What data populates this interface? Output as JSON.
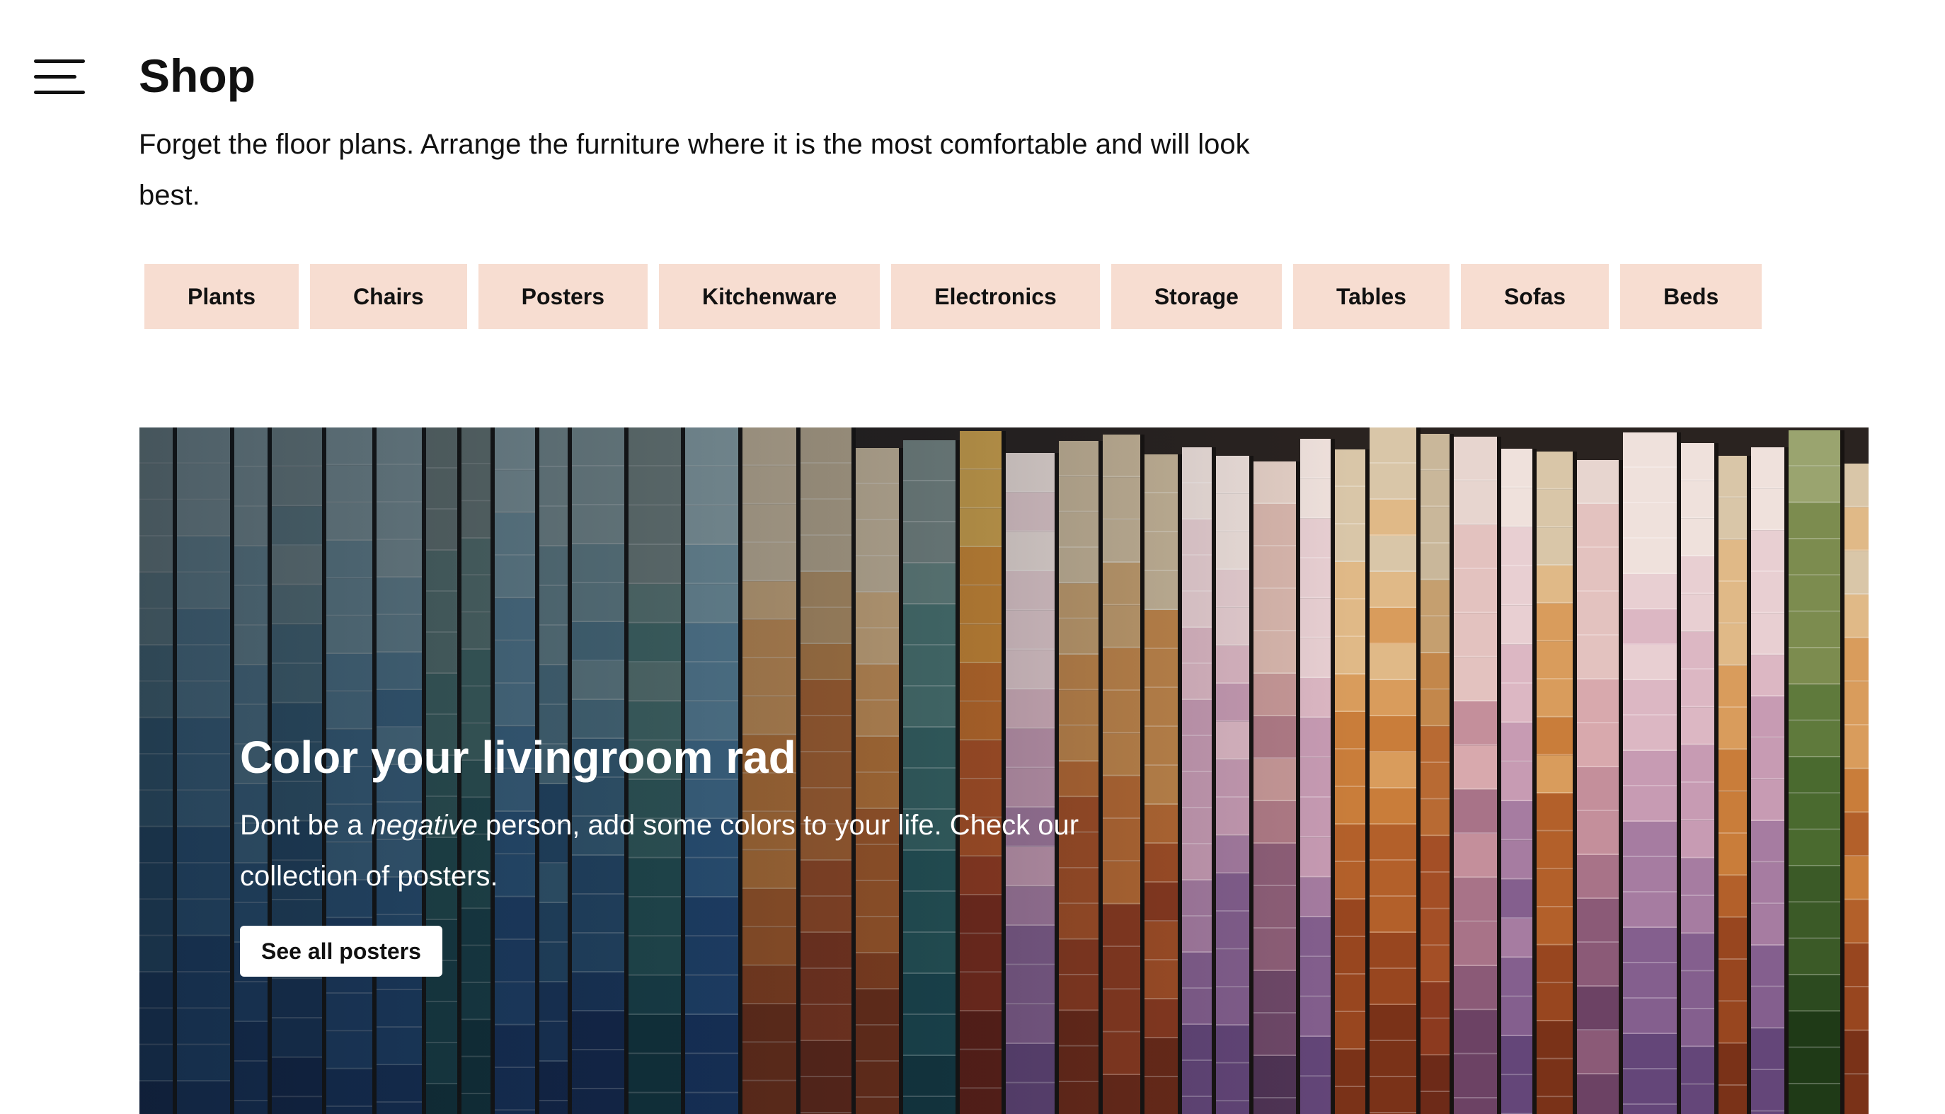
{
  "header": {
    "menu_icon": "hamburger-menu-icon",
    "title": "Shop",
    "intro": "Forget the floor plans. Arrange the furniture where it is the most comfortable and will look best."
  },
  "categories": [
    {
      "label": "Plants"
    },
    {
      "label": "Chairs"
    },
    {
      "label": "Posters"
    },
    {
      "label": "Kitchenware"
    },
    {
      "label": "Electronics"
    },
    {
      "label": "Storage"
    },
    {
      "label": "Tables"
    },
    {
      "label": "Sofas"
    },
    {
      "label": "Beds"
    }
  ],
  "category_color": "#f7ddd1",
  "hero": {
    "title": "Color your livingroom rad",
    "desc_before": "Dont be a ",
    "desc_em": "negative",
    "desc_after": " person, add some colors to your life. Check our collection of posters.",
    "button_label": "See all posters"
  }
}
